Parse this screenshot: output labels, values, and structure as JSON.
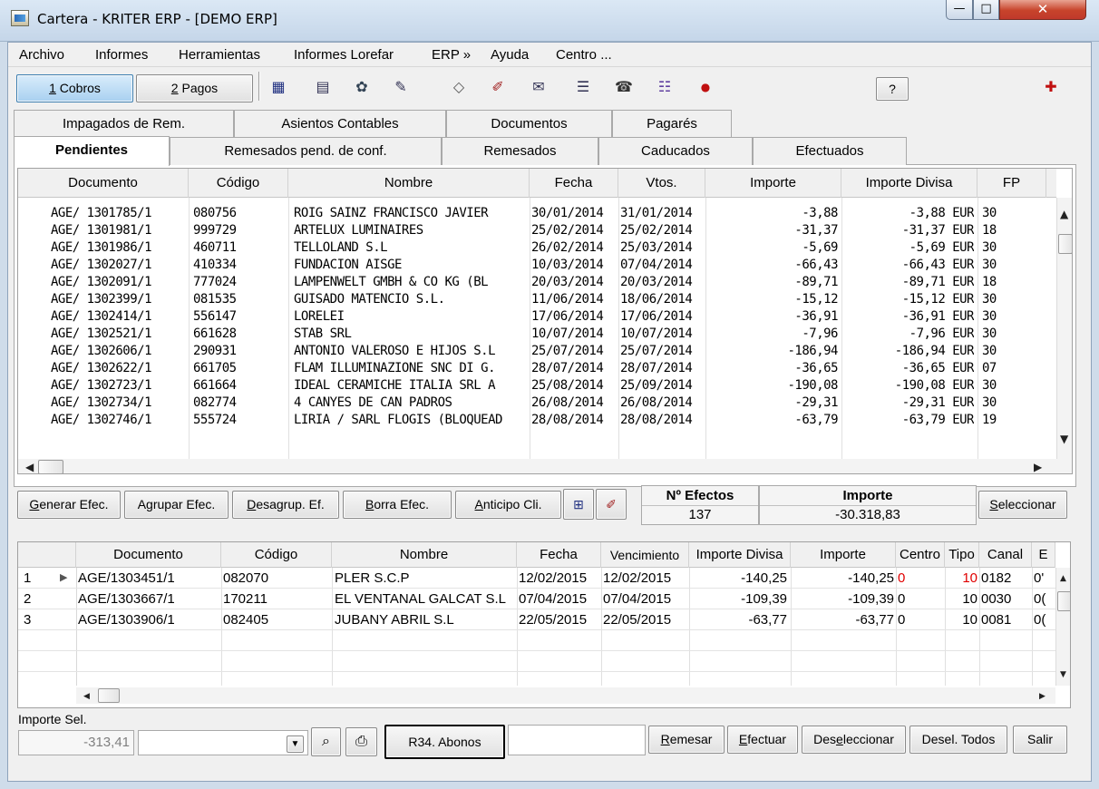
{
  "window": {
    "title": "Cartera - KRITER ERP - [DEMO ERP]",
    "min": "—",
    "max": "□",
    "close": "✕"
  },
  "menu": [
    "Archivo",
    "Informes",
    "Herramientas",
    "Informes Lorefar",
    "ERP »",
    "Ayuda",
    "Centro ..."
  ],
  "toolbar": {
    "cobros": {
      "key": "1",
      "label": " Cobros"
    },
    "pagos": {
      "key": "2",
      "label": " Pagos"
    },
    "help_label": "?",
    "icons": [
      "calculator-icon",
      "calendar-icon",
      "tools-icon",
      "edit-note-icon",
      "eraser-icon",
      "marker-icon",
      "phonebook-icon",
      "list-icon",
      "phone-icon",
      "checklist-icon",
      "bird-icon",
      "lifebuoy-icon"
    ]
  },
  "tabs_row1": [
    "Impagados de Rem.",
    "Asientos Contables",
    "Documentos",
    "Pagarés"
  ],
  "tabs_row2": [
    "Pendientes",
    "Remesados pend. de conf.",
    "Remesados",
    "Caducados",
    "Efectuados"
  ],
  "grid1": {
    "columns": [
      "Documento",
      "Código",
      "Nombre",
      "Fecha",
      "Vtos.",
      "Importe",
      "Importe Divisa",
      "FP"
    ],
    "rows": [
      [
        "AGE/ 1301785/1",
        "080756",
        "ROIG SAINZ FRANCISCO JAVIER",
        "30/01/2014",
        "31/01/2014",
        "-3,88",
        "-3,88 EUR",
        "30"
      ],
      [
        "AGE/ 1301981/1",
        "999729",
        "ARTELUX LUMINAIRES",
        "25/02/2014",
        "25/02/2014",
        "-31,37",
        "-31,37 EUR",
        "18"
      ],
      [
        "AGE/ 1301986/1",
        "460711",
        "TELLOLAND S.L",
        "26/02/2014",
        "25/03/2014",
        "-5,69",
        "-5,69 EUR",
        "30"
      ],
      [
        "AGE/ 1302027/1",
        "410334",
        "FUNDACION AISGE",
        "10/03/2014",
        "07/04/2014",
        "-66,43",
        "-66,43 EUR",
        "30"
      ],
      [
        "AGE/ 1302091/1",
        "777024",
        "LAMPENWELT GMBH & CO KG (BL",
        "20/03/2014",
        "20/03/2014",
        "-89,71",
        "-89,71 EUR",
        "18"
      ],
      [
        "AGE/ 1302399/1",
        "081535",
        "GUISADO MATENCIO S.L.",
        "11/06/2014",
        "18/06/2014",
        "-15,12",
        "-15,12 EUR",
        "30"
      ],
      [
        "AGE/ 1302414/1",
        "556147",
        "LORELEI",
        "17/06/2014",
        "17/06/2014",
        "-36,91",
        "-36,91 EUR",
        "30"
      ],
      [
        "AGE/ 1302521/1",
        "661628",
        "STAB SRL",
        "10/07/2014",
        "10/07/2014",
        "-7,96",
        "-7,96 EUR",
        "30"
      ],
      [
        "AGE/ 1302606/1",
        "290931",
        "ANTONIO VALEROSO E HIJOS S.L",
        "25/07/2014",
        "25/07/2014",
        "-186,94",
        "-186,94 EUR",
        "30"
      ],
      [
        "AGE/ 1302622/1",
        "661705",
        "FLAM ILLUMINAZIONE SNC DI G.",
        "28/07/2014",
        "28/07/2014",
        "-36,65",
        "-36,65 EUR",
        "07"
      ],
      [
        "AGE/ 1302723/1",
        "661664",
        "IDEAL CERAMICHE ITALIA SRL A",
        "25/08/2014",
        "25/09/2014",
        "-190,08",
        "-190,08 EUR",
        "30"
      ],
      [
        "AGE/ 1302734/1",
        "082774",
        "4 CANYES DE CAN PADROS",
        "26/08/2014",
        "26/08/2014",
        "-29,31",
        "-29,31 EUR",
        "30"
      ],
      [
        "AGE/ 1302746/1",
        "555724",
        "LIRIA / SARL FLOGIS (BLOQUEAD",
        "28/08/2014",
        "28/08/2014",
        "-63,79",
        "-63,79 EUR",
        "19"
      ]
    ]
  },
  "actions": {
    "generar": {
      "key": "G",
      "rest": "enerar Efec."
    },
    "agrupar": {
      "pre": "A",
      "key": "g",
      "rest": "rupar Efec."
    },
    "desagrupar": {
      "key": "D",
      "rest": "esagrup. Ef."
    },
    "borra": {
      "key": "B",
      "rest": "orra Efec."
    },
    "anticipo": {
      "key": "A",
      "rest": "nticipo Cli."
    },
    "seleccionar": {
      "key": "S",
      "rest": "eleccionar"
    }
  },
  "summary": {
    "efectos_label": "Nº Efectos",
    "efectos_value": "137",
    "importe_label": "Importe",
    "importe_value": "-30.318,83"
  },
  "grid2": {
    "columns": [
      "",
      "Documento",
      "Código",
      "Nombre",
      "Fecha",
      "Vencimiento",
      "Importe Divisa",
      "Importe",
      "Centro",
      "Tipo",
      "Canal",
      "E"
    ],
    "rows": [
      {
        "n": "1",
        "doc": "AGE/1303451/1",
        "cod": "082070",
        "nombre": "PLER S.C.P",
        "fecha": "12/02/2015",
        "venc": "12/02/2015",
        "divisa": "-140,25",
        "importe": "-140,25",
        "centro": "0",
        "tipo": "10",
        "canal": "0182",
        "e": "0'"
      },
      {
        "n": "2",
        "doc": "AGE/1303667/1",
        "cod": "170211",
        "nombre": "EL VENTANAL GALCAT S.L",
        "fecha": "07/04/2015",
        "venc": "07/04/2015",
        "divisa": "-109,39",
        "importe": "-109,39",
        "centro": "0",
        "tipo": "10",
        "canal": "0030",
        "e": "0("
      },
      {
        "n": "3",
        "doc": "AGE/1303906/1",
        "cod": "082405",
        "nombre": "JUBANY ABRIL S.L",
        "fecha": "22/05/2015",
        "venc": "22/05/2015",
        "divisa": "-63,77",
        "importe": "-63,77",
        "centro": "0",
        "tipo": "10",
        "canal": "0081",
        "e": "0("
      }
    ]
  },
  "bottom": {
    "importe_sel_label": "Importe Sel.",
    "importe_sel_value": "-313,41",
    "r34_label": "R34. Abonos",
    "remesar": {
      "key": "R",
      "rest": "emesar"
    },
    "efectuar": {
      "key": "E",
      "rest": "fectuar"
    },
    "deseleccionar": {
      "pre": "Des",
      "key": "e",
      "rest": "leccionar"
    },
    "desel_todos": "Desel. Todos",
    "salir": "Salir"
  },
  "colors": {
    "accent": "#3c7fb1",
    "red": "#e00000"
  }
}
